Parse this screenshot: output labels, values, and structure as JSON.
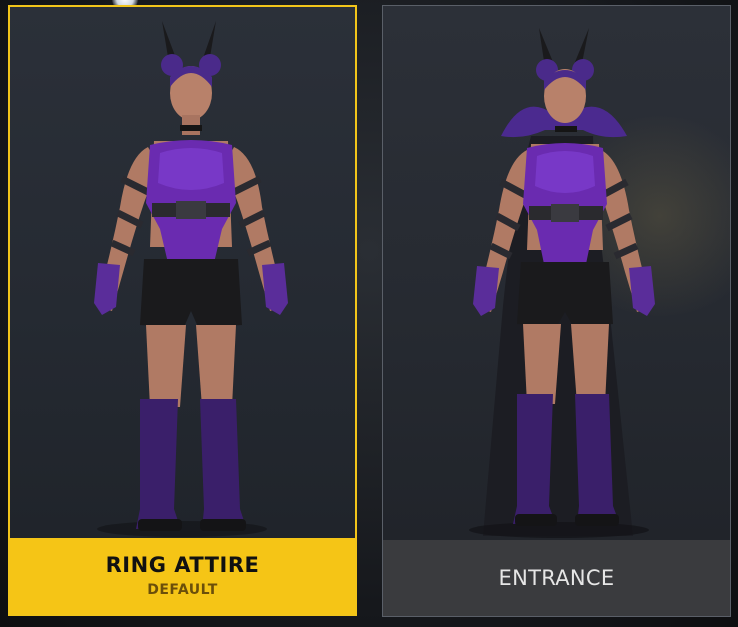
{
  "attire_options": [
    {
      "title": "RING ATTIRE",
      "subtitle": "DEFAULT",
      "selected": true
    },
    {
      "title": "ENTRANCE",
      "selected": false
    }
  ],
  "colors": {
    "selected_accent": "#f5c516",
    "unselected_panel": "#3a3b3e",
    "costume_purple": "#6a2bb0"
  }
}
